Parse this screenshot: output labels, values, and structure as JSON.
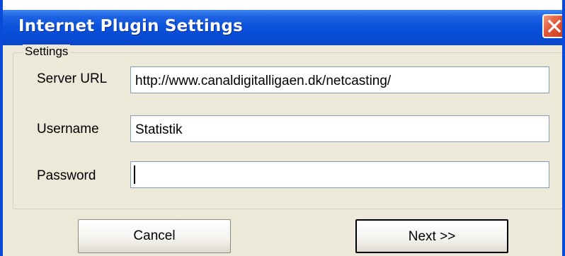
{
  "window": {
    "title": "Internet Plugin Settings",
    "close_symbol": "close-icon"
  },
  "group": {
    "label": "Settings"
  },
  "fields": {
    "server_url": {
      "label": "Server URL",
      "value": "http://www.canaldigitalligaen.dk/netcasting/"
    },
    "username": {
      "label": "Username",
      "value": "Statistik"
    },
    "password": {
      "label": "Password",
      "value": ""
    }
  },
  "buttons": {
    "cancel": "Cancel",
    "next": "Next >>"
  },
  "colors": {
    "titlebar": "#0a52db",
    "close": "#e2583a",
    "face": "#ece9d8",
    "input_border": "#7f9db9"
  }
}
